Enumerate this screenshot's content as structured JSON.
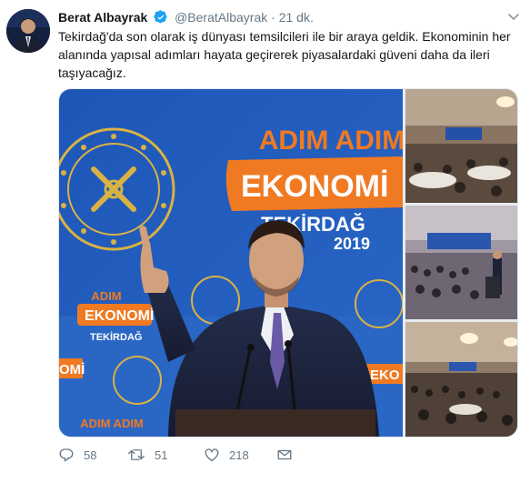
{
  "tweet": {
    "author_name": "Berat Albayrak",
    "handle": "@BeratAlbayrak",
    "separator": "·",
    "time": "21 dk.",
    "text": "Tekirdağ'da son olarak iş dünyası temsilcileri ile bir araya geldik. Ekonominin her alanında yapısal adımları hayata geçirerek piyasalardaki güveni daha da ileri taşıyacağız."
  },
  "media": {
    "banner_line1": "ADIM ADIM",
    "banner_line2": "EKONOMİ",
    "banner_city": "TEKİRDAĞ",
    "banner_year": "2019",
    "small_banner_line1": "ADIM",
    "small_banner_line2": "EKONOMİ",
    "small_banner_city": "TEKİRDAĞ",
    "right_banner_line2": "EKO",
    "left_banner_line2": "OMİ",
    "bottom_banner_line1": "ADIM ADIM",
    "emblem_text": "TÜRKİYE CUMHURİYETİ HAZİNE VE MALİYE BAKANLIĞI"
  },
  "actions": {
    "reply_count": "58",
    "retweet_count": "51",
    "like_count": "218"
  },
  "colors": {
    "banner_blue": "#1f57b8",
    "banner_orange": "#f07a22",
    "text_secondary": "#657786",
    "verified": "#1da1f2"
  },
  "icons": [
    "verified-badge-icon",
    "chevron-down-icon",
    "reply-icon",
    "retweet-icon",
    "like-icon",
    "share-icon"
  ]
}
